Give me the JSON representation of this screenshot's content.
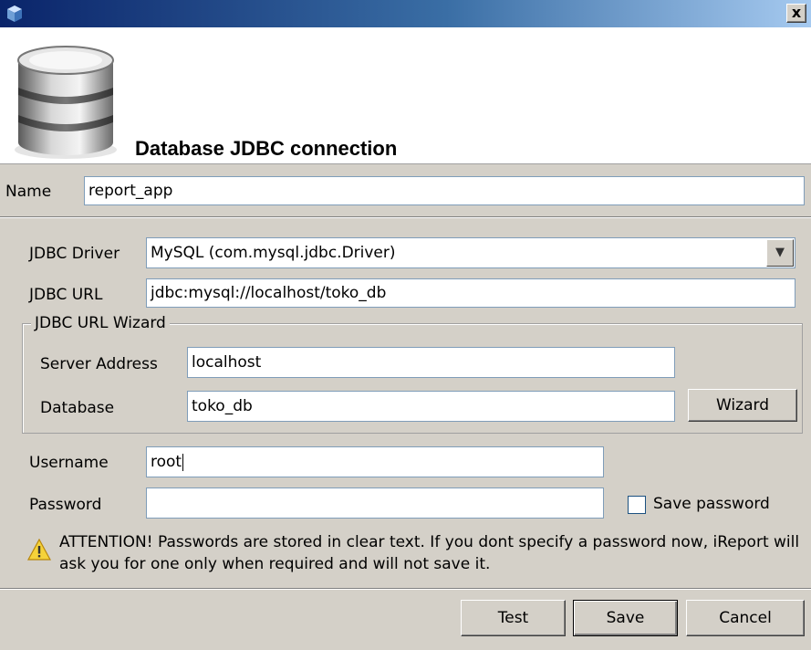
{
  "window": {
    "title": "",
    "close_label": "x"
  },
  "header": {
    "title": "Database JDBC connection",
    "icon": "database-icon"
  },
  "name_field": {
    "label": "Name",
    "value": "report_app"
  },
  "connection": {
    "driver_label": "JDBC Driver",
    "driver_value": "MySQL (com.mysql.jdbc.Driver)",
    "url_label": "JDBC URL",
    "url_value": "jdbc:mysql://localhost/toko_db"
  },
  "wizard_group": {
    "title": "JDBC URL Wizard",
    "server_label": "Server Address",
    "server_value": "localhost",
    "database_label": "Database",
    "database_value": "toko_db",
    "wizard_button": "Wizard"
  },
  "credentials": {
    "username_label": "Username",
    "username_value": "root",
    "password_label": "Password",
    "password_value": "",
    "save_password_label": "Save password",
    "save_password_checked": false
  },
  "warning": {
    "icon": "warning-icon",
    "text": "ATTENTION! Passwords are stored in clear text. If you dont specify a password now, iReport will ask you for one only when required and will not save it."
  },
  "buttons": {
    "test": "Test",
    "save": "Save",
    "cancel": "Cancel"
  },
  "colors": {
    "title_bar_start": "#0a246a",
    "title_bar_end": "#a6caf0",
    "dialog_bg": "#d4d0c8",
    "field_border": "#7f9db9"
  }
}
